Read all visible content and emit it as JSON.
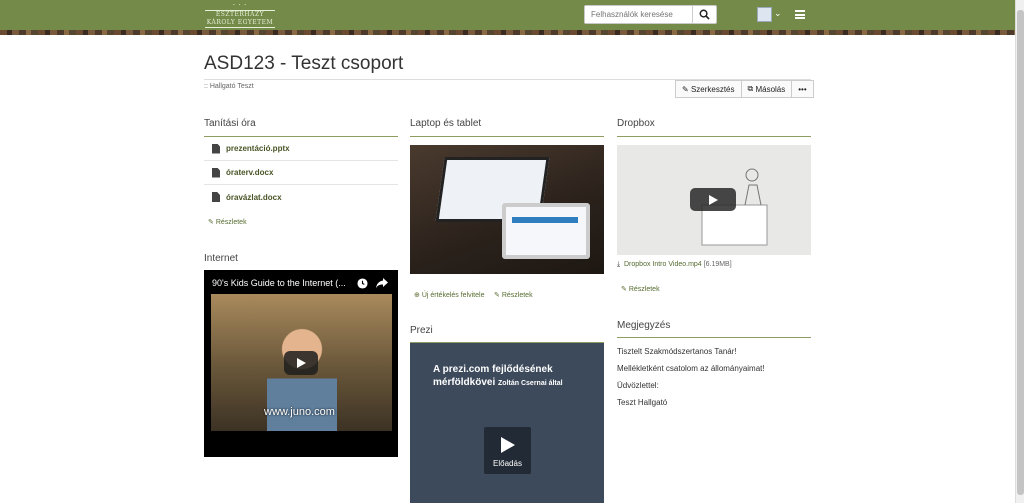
{
  "header": {
    "logo_lines": [
      "ESZTERHÁZY KÁROLY EGYETEM"
    ],
    "search_placeholder": "Felhasználók keresése",
    "icons": {
      "search": "search-icon",
      "avatar": "avatar",
      "menu": "hamburger-icon"
    }
  },
  "group": {
    "title": "ASD123 - Teszt csoport",
    "owner": ":: Hallgató Teszt",
    "actions": {
      "edit": "Szerkesztés",
      "copy": "Másolás",
      "more": "•••"
    }
  },
  "tanitasi_ora": {
    "title": "Tanítási óra",
    "files": [
      "prezentáció.pptx",
      "óraterv.docx",
      "óravázlat.docx"
    ],
    "details": "Részletek"
  },
  "internet": {
    "title": "Internet",
    "video_title": "90's Kids Guide to the Internet (...",
    "video_url_text": "www.juno.com"
  },
  "laptop": {
    "title": "Laptop és tablet",
    "new_rating": "Új értékelés felvitele",
    "details": "Részletek"
  },
  "dropbox": {
    "title": "Dropbox",
    "file_link": "Dropbox Intro Video.mp4",
    "file_size": "[6.19MB]",
    "details": "Részletek"
  },
  "prezi": {
    "title": "Prezi",
    "line1": "A prezi.com fejlődésének",
    "line2": "mérföldkövei",
    "line2_small": "Zoltán Csernai által",
    "play_label": "Előadás"
  },
  "megjegyzes": {
    "title": "Megjegyzés",
    "lines": [
      "Tisztelt Szakmódszertanos Tanár!",
      "Mellékletként csatolom az állományaimat!",
      "Üdvözlettel:",
      "Teszt Hallgató"
    ]
  },
  "colors": {
    "header_green": "#738a49",
    "accent_line": "#8d9d62",
    "link": "#556b2f"
  }
}
